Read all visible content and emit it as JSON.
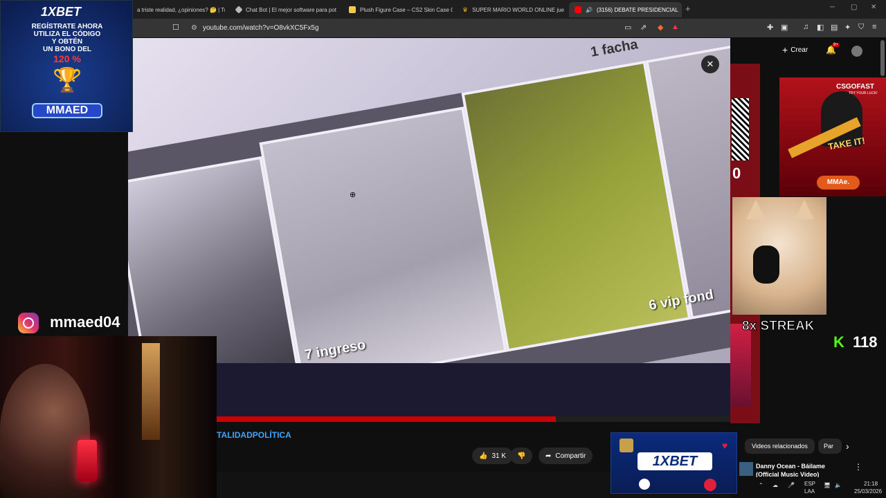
{
  "browser": {
    "tabs": [
      {
        "title": "a triste realidad, ¿opiniones? 🤔 | Tr",
        "fav_color": "#444"
      },
      {
        "title": "Chat Bot | El mejor software para pot",
        "fav_color": "#bbbbbb"
      },
      {
        "title": "Plush Figure Case – CS2 Skin Case O",
        "fav_color": "#f2c94c"
      },
      {
        "title": "SUPER MARIO WORLD ONLINE jueg",
        "fav_color": "#e6a81a"
      },
      {
        "title": "(3156) DEBATE PRESIDENCIAL",
        "fav_color": "#ff0000",
        "active": true
      }
    ],
    "url": "youtube.com/watch?v=O8vkXC5Fx5g"
  },
  "youtube": {
    "create_label": "Crear",
    "notif_badge": "9+",
    "hashtag": "#REALIDADPOLÍTICA",
    "hashtag_visible": "TALIDADPOLÍTICA",
    "likes": "31 K",
    "share_label": "Compartir",
    "chips": [
      "Videos relacionados",
      "Par"
    ],
    "related": {
      "title": "Danny Ocean - Báilame (Official Music Video)"
    },
    "progress": 0.66
  },
  "video": {
    "labels": {
      "top": "1 facha",
      "right": "6 vip fond",
      "bottom": "7 ingreso"
    }
  },
  "overlays": {
    "ad_top_left": {
      "brand": "1XBET",
      "line1": "REGÍSTRATE AHORA",
      "line2": "UTILIZA EL CÓDIGO",
      "line3": "Y OBTÉN",
      "line4": "UN BONO DEL",
      "bonus": "120 %",
      "code": "MMAED"
    },
    "ad_cs": {
      "title": "CSGOFAST",
      "subtitle": "TRY YOUR LUCK!",
      "tagline": "TAKE IT!",
      "badge": "MMAe."
    },
    "instagram_handle": "mmaed04",
    "streak": "8x STREAK",
    "kick_count": "118",
    "kick_logo": "K",
    "side_number": "0",
    "ad_bottom_brand": "1XBET"
  },
  "tray": {
    "lang": "ESP",
    "layout": "LAA",
    "time": "21:18",
    "date": "25/03/2026"
  }
}
